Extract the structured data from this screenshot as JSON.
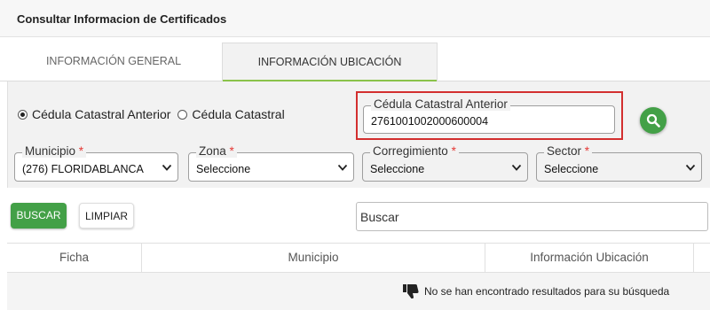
{
  "header": {
    "title": "Consultar Informacion de Certificados"
  },
  "tabs": [
    {
      "label": "INFORMACIÓN GENERAL",
      "active": false
    },
    {
      "label": "INFORMACIÓN UBICACIÓN",
      "active": true
    }
  ],
  "search_type": {
    "options": [
      {
        "label": "Cédula Catastral Anterior",
        "selected": true
      },
      {
        "label": "Cédula Catastral",
        "selected": false
      }
    ]
  },
  "cedula": {
    "label": "Cédula Catastral Anterior",
    "value": "2761001002000600004"
  },
  "filters": {
    "municipio": {
      "label": "Municipio",
      "required": "*",
      "value": "(276) FLORIDABLANCA"
    },
    "zona": {
      "label": "Zona",
      "required": "*",
      "value": "Seleccione"
    },
    "corregimiento": {
      "label": "Corregimiento",
      "required": "*",
      "value": "Seleccione"
    },
    "sector": {
      "label": "Sector",
      "required": "*",
      "value": "Seleccione"
    }
  },
  "actions": {
    "buscar_label": "BUSCAR",
    "limpiar_label": "LIMPIAR"
  },
  "search": {
    "placeholder": "Buscar"
  },
  "table": {
    "columns": [
      "Ficha",
      "Municipio",
      "Información Ubicación"
    ],
    "empty_message": "No se han encontrado resultados para su búsqueda"
  },
  "colors": {
    "accent_green": "#43a047",
    "tab_underline": "#8bc34a",
    "highlight_red": "#d32f2f",
    "required_red": "#e53935"
  },
  "icons": {
    "search": "magnifier-icon",
    "empty": "thumbs-down-icon",
    "chevron": "chevron-down-icon"
  }
}
